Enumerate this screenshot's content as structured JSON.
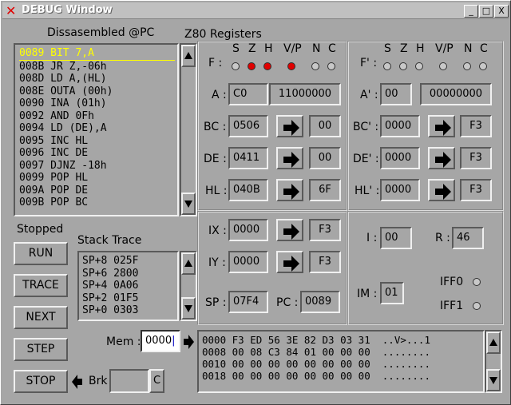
{
  "window": {
    "title": "DEBUG Window",
    "buttons": [
      "_",
      "□",
      "X"
    ]
  },
  "disasm": {
    "title": "Dissasembled @PC",
    "lines": [
      "0089 BIT 7,A",
      "008B JR Z,-06h",
      "008D LD A,(HL)",
      "008E OUTA (00h)",
      "0090 INA (01h)",
      "0092 AND 0Fh",
      "0094 LD (DE),A",
      "0095 INC HL",
      "0096 INC DE",
      "0097 DJNZ -18h",
      "0099 POP HL",
      "009A POP DE",
      "009B POP BC"
    ]
  },
  "status": "Stopped",
  "buttons": {
    "run": "RUN",
    "trace": "TRACE",
    "next": "NEXT",
    "step": "STEP",
    "stop": "STOP"
  },
  "stack": {
    "title": "Stack Trace",
    "lines": [
      "SP+8 025F",
      "SP+6 2800",
      "SP+4 0A06",
      "SP+2 01F5",
      "SP+0 0303"
    ]
  },
  "mem": {
    "label": "Mem :",
    "addr": "0000",
    "brk_label": "Brk",
    "brk_value": "",
    "brk_btn": "C",
    "lines": [
      "0000 F3 ED 56 3E 82 D3 03 31  ..V>...1",
      "0008 00 08 C3 84 01 00 00 00  ........",
      "0010 00 00 00 00 00 00 00 00  ........",
      "0018 00 00 00 00 00 00 00 00  ........"
    ]
  },
  "regs": {
    "title": "Z80 Registers",
    "flag_names": [
      "S",
      "Z",
      "H",
      "V/P",
      "N",
      "C"
    ],
    "F_label": "F :",
    "F2_label": "F' :",
    "flags": [
      false,
      true,
      true,
      true,
      false,
      false
    ],
    "flags2": [
      false,
      false,
      false,
      false,
      false,
      false
    ],
    "A": {
      "label": "A :",
      "hex": "C0",
      "bin": "11000000"
    },
    "A2": {
      "label": "A' :",
      "hex": "00",
      "bin": "00000000"
    },
    "BC": {
      "label": "BC :",
      "val": "0506",
      "mem": "00"
    },
    "DE": {
      "label": "DE :",
      "val": "0411",
      "mem": "00"
    },
    "HL": {
      "label": "HL :",
      "val": "040B",
      "mem": "6F"
    },
    "BC2": {
      "label": "BC' :",
      "val": "0000",
      "mem": "F3"
    },
    "DE2": {
      "label": "DE' :",
      "val": "0000",
      "mem": "F3"
    },
    "HL2": {
      "label": "HL' :",
      "val": "0000",
      "mem": "F3"
    },
    "IX": {
      "label": "IX :",
      "val": "0000",
      "mem": "F3"
    },
    "IY": {
      "label": "IY :",
      "val": "0000",
      "mem": "F3"
    },
    "SP": {
      "label": "SP :",
      "val": "07F4"
    },
    "PC": {
      "label": "PC :",
      "val": "0089"
    },
    "I": {
      "label": "I :",
      "val": "00"
    },
    "R": {
      "label": "R :",
      "val": "46"
    },
    "IM": {
      "label": "IM :",
      "val": "01"
    },
    "IFF0": "IFF0",
    "IFF1": "IFF1"
  }
}
